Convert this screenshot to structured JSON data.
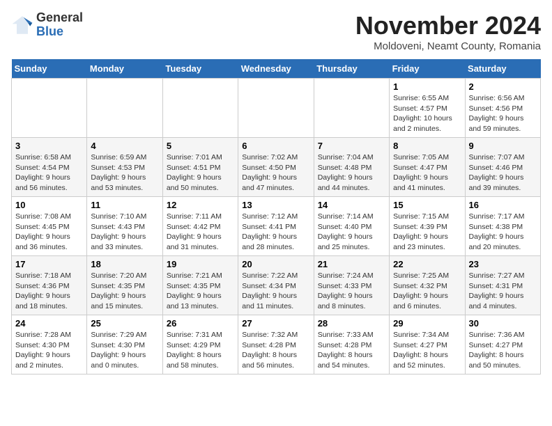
{
  "logo": {
    "general": "General",
    "blue": "Blue"
  },
  "title": "November 2024",
  "location": "Moldoveni, Neamt County, Romania",
  "days_of_week": [
    "Sunday",
    "Monday",
    "Tuesday",
    "Wednesday",
    "Thursday",
    "Friday",
    "Saturday"
  ],
  "weeks": [
    [
      {
        "day": "",
        "info": ""
      },
      {
        "day": "",
        "info": ""
      },
      {
        "day": "",
        "info": ""
      },
      {
        "day": "",
        "info": ""
      },
      {
        "day": "",
        "info": ""
      },
      {
        "day": "1",
        "info": "Sunrise: 6:55 AM\nSunset: 4:57 PM\nDaylight: 10 hours and 2 minutes."
      },
      {
        "day": "2",
        "info": "Sunrise: 6:56 AM\nSunset: 4:56 PM\nDaylight: 9 hours and 59 minutes."
      }
    ],
    [
      {
        "day": "3",
        "info": "Sunrise: 6:58 AM\nSunset: 4:54 PM\nDaylight: 9 hours and 56 minutes."
      },
      {
        "day": "4",
        "info": "Sunrise: 6:59 AM\nSunset: 4:53 PM\nDaylight: 9 hours and 53 minutes."
      },
      {
        "day": "5",
        "info": "Sunrise: 7:01 AM\nSunset: 4:51 PM\nDaylight: 9 hours and 50 minutes."
      },
      {
        "day": "6",
        "info": "Sunrise: 7:02 AM\nSunset: 4:50 PM\nDaylight: 9 hours and 47 minutes."
      },
      {
        "day": "7",
        "info": "Sunrise: 7:04 AM\nSunset: 4:48 PM\nDaylight: 9 hours and 44 minutes."
      },
      {
        "day": "8",
        "info": "Sunrise: 7:05 AM\nSunset: 4:47 PM\nDaylight: 9 hours and 41 minutes."
      },
      {
        "day": "9",
        "info": "Sunrise: 7:07 AM\nSunset: 4:46 PM\nDaylight: 9 hours and 39 minutes."
      }
    ],
    [
      {
        "day": "10",
        "info": "Sunrise: 7:08 AM\nSunset: 4:45 PM\nDaylight: 9 hours and 36 minutes."
      },
      {
        "day": "11",
        "info": "Sunrise: 7:10 AM\nSunset: 4:43 PM\nDaylight: 9 hours and 33 minutes."
      },
      {
        "day": "12",
        "info": "Sunrise: 7:11 AM\nSunset: 4:42 PM\nDaylight: 9 hours and 31 minutes."
      },
      {
        "day": "13",
        "info": "Sunrise: 7:12 AM\nSunset: 4:41 PM\nDaylight: 9 hours and 28 minutes."
      },
      {
        "day": "14",
        "info": "Sunrise: 7:14 AM\nSunset: 4:40 PM\nDaylight: 9 hours and 25 minutes."
      },
      {
        "day": "15",
        "info": "Sunrise: 7:15 AM\nSunset: 4:39 PM\nDaylight: 9 hours and 23 minutes."
      },
      {
        "day": "16",
        "info": "Sunrise: 7:17 AM\nSunset: 4:38 PM\nDaylight: 9 hours and 20 minutes."
      }
    ],
    [
      {
        "day": "17",
        "info": "Sunrise: 7:18 AM\nSunset: 4:36 PM\nDaylight: 9 hours and 18 minutes."
      },
      {
        "day": "18",
        "info": "Sunrise: 7:20 AM\nSunset: 4:35 PM\nDaylight: 9 hours and 15 minutes."
      },
      {
        "day": "19",
        "info": "Sunrise: 7:21 AM\nSunset: 4:35 PM\nDaylight: 9 hours and 13 minutes."
      },
      {
        "day": "20",
        "info": "Sunrise: 7:22 AM\nSunset: 4:34 PM\nDaylight: 9 hours and 11 minutes."
      },
      {
        "day": "21",
        "info": "Sunrise: 7:24 AM\nSunset: 4:33 PM\nDaylight: 9 hours and 8 minutes."
      },
      {
        "day": "22",
        "info": "Sunrise: 7:25 AM\nSunset: 4:32 PM\nDaylight: 9 hours and 6 minutes."
      },
      {
        "day": "23",
        "info": "Sunrise: 7:27 AM\nSunset: 4:31 PM\nDaylight: 9 hours and 4 minutes."
      }
    ],
    [
      {
        "day": "24",
        "info": "Sunrise: 7:28 AM\nSunset: 4:30 PM\nDaylight: 9 hours and 2 minutes."
      },
      {
        "day": "25",
        "info": "Sunrise: 7:29 AM\nSunset: 4:30 PM\nDaylight: 9 hours and 0 minutes."
      },
      {
        "day": "26",
        "info": "Sunrise: 7:31 AM\nSunset: 4:29 PM\nDaylight: 8 hours and 58 minutes."
      },
      {
        "day": "27",
        "info": "Sunrise: 7:32 AM\nSunset: 4:28 PM\nDaylight: 8 hours and 56 minutes."
      },
      {
        "day": "28",
        "info": "Sunrise: 7:33 AM\nSunset: 4:28 PM\nDaylight: 8 hours and 54 minutes."
      },
      {
        "day": "29",
        "info": "Sunrise: 7:34 AM\nSunset: 4:27 PM\nDaylight: 8 hours and 52 minutes."
      },
      {
        "day": "30",
        "info": "Sunrise: 7:36 AM\nSunset: 4:27 PM\nDaylight: 8 hours and 50 minutes."
      }
    ]
  ]
}
